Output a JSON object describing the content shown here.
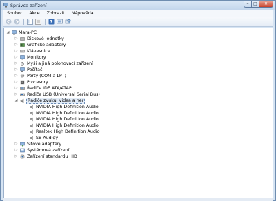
{
  "window": {
    "title": "Správce zařízení",
    "minimize_symbol": "–",
    "maximize_symbol": "□",
    "close_symbol": "✕"
  },
  "menu": [
    "Soubor",
    "Akce",
    "Zobrazit",
    "Nápověda"
  ],
  "toolbar": {
    "buttons": [
      "back-icon",
      "forward-icon",
      "properties-icon",
      "console-tree-icon",
      "help-icon",
      "scan-hardware-icon"
    ]
  },
  "tree": {
    "root": "Mara-PC",
    "categories": [
      {
        "label": "Diskové jednotky",
        "icon": "disk-drive-icon",
        "expanded": false
      },
      {
        "label": "Grafické adaptéry",
        "icon": "display-adapter-icon",
        "expanded": false
      },
      {
        "label": "Klávesnice",
        "icon": "keyboard-icon",
        "expanded": false
      },
      {
        "label": "Monitory",
        "icon": "monitor-icon",
        "expanded": false
      },
      {
        "label": "Myši a jiná polohovací zařízení",
        "icon": "mouse-icon",
        "expanded": false
      },
      {
        "label": "Počítač",
        "icon": "computer-icon",
        "expanded": false
      },
      {
        "label": "Porty (COM a LPT)",
        "icon": "port-icon",
        "expanded": false
      },
      {
        "label": "Procesory",
        "icon": "processor-icon",
        "expanded": false
      },
      {
        "label": "Řadiče IDE ATA/ATAPI",
        "icon": "ide-controller-icon",
        "expanded": false
      },
      {
        "label": "Řadiče USB (Universal Serial Bus)",
        "icon": "usb-controller-icon",
        "expanded": false
      },
      {
        "label": "Řadiče zvuku, videa a her",
        "icon": "sound-icon",
        "expanded": true,
        "selected": true,
        "children": [
          "NVIDIA High Definition Audio",
          "NVIDIA High Definition Audio",
          "NVIDIA High Definition Audio",
          "NVIDIA High Definition Audio",
          "Realtek High Definition Audio",
          "SB Audigy"
        ]
      },
      {
        "label": "Síťové adaptéry",
        "icon": "network-adapter-icon",
        "expanded": false
      },
      {
        "label": "Systémová zařízení",
        "icon": "system-device-icon",
        "expanded": false
      },
      {
        "label": "Zařízení standardu HID",
        "icon": "hid-device-icon",
        "expanded": false
      }
    ]
  },
  "colors": {
    "title_bar": "#c3d6ec",
    "selection": "#e2ecf8",
    "close_button": "#c8412b"
  }
}
